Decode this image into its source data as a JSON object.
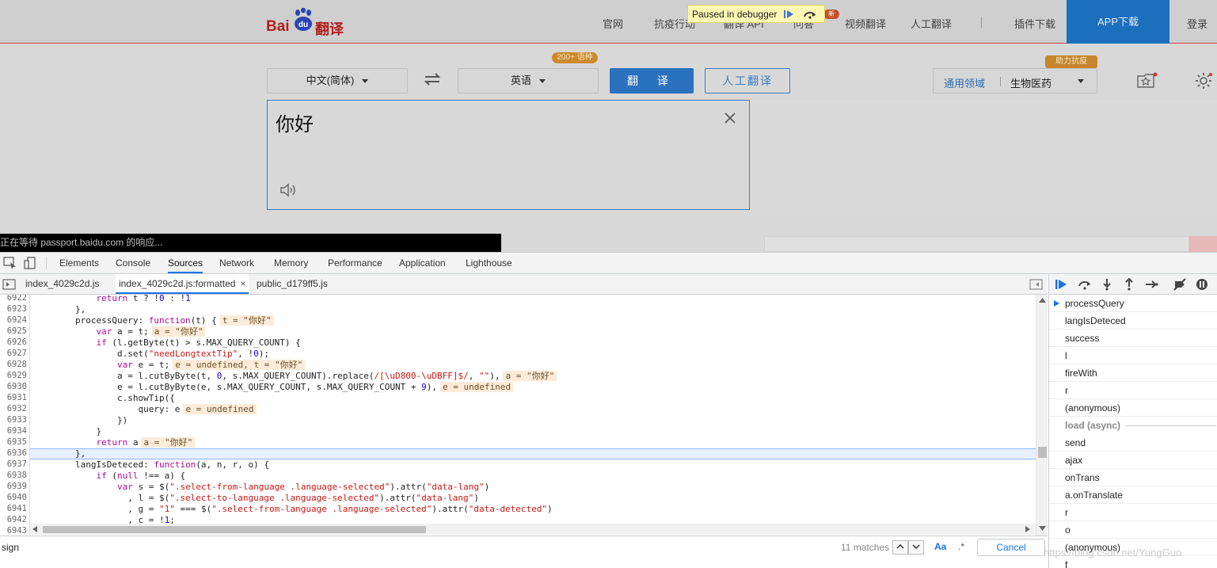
{
  "site": {
    "logo_bai": "Bai",
    "logo_du": "du",
    "logo_fanyi": "翻译",
    "nav": [
      "官网",
      "抗疫行动",
      "翻译 API",
      "问答",
      "视频翻译",
      "人工翻译",
      "插件下载"
    ],
    "app_download": "APP下载",
    "login": "登录",
    "new_badge": "新",
    "source_lang": "中文(简体)",
    "target_lang": "英语",
    "lang_count": "200+ 语种",
    "translate_btn": "翻 译",
    "human_btn": "人工翻译",
    "domain_label": "通用领域",
    "domain_value": "生物医药",
    "help_badge": "助力抗疫",
    "input_text": "你好",
    "status": "正在等待 passport.baidu.com 的响应..."
  },
  "debugger_banner": {
    "text": "Paused in debugger"
  },
  "devtools": {
    "tabs": [
      "Elements",
      "Console",
      "Sources",
      "Network",
      "Memory",
      "Performance",
      "Application",
      "Lighthouse"
    ],
    "active_tab": "Sources",
    "file_tabs": [
      "index_4029c2d.js",
      "index_4029c2d.js:formatted",
      "public_d179ff5.js"
    ],
    "file_close": "×",
    "line_numbers": [
      "6922",
      "6923",
      "6924",
      "6925",
      "6926",
      "6927",
      "6928",
      "6929",
      "6930",
      "6931",
      "6932",
      "6933",
      "6934",
      "6935",
      "6936",
      "6937",
      "6938",
      "6939",
      "6940",
      "6941",
      "6942",
      "6943"
    ],
    "highlight_line": "6936",
    "search": {
      "value": "sign",
      "matches": "11 matches",
      "aa": "Aa",
      "regex": ".*",
      "cancel": "Cancel"
    },
    "call_stack": [
      "processQuery",
      "langIsDeteced",
      "success",
      "l",
      "fireWith",
      "r",
      "(anonymous)"
    ],
    "async_label": "load (async)",
    "call_stack_async": [
      "send",
      "ajax",
      "onTrans",
      "a.onTranslate",
      "r",
      "o",
      "(anonymous)",
      "f"
    ],
    "watermark": "https://blog.csdn.net/YungGuo"
  }
}
